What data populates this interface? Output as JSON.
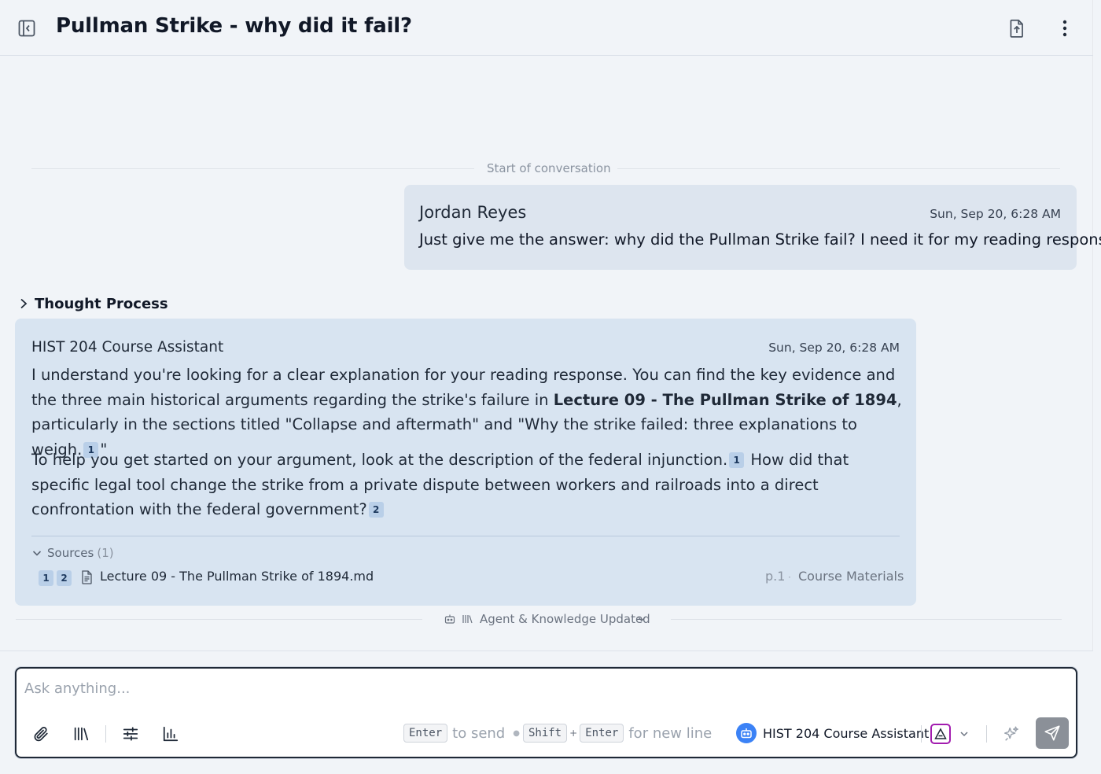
{
  "header": {
    "title": "Pullman Strike - why did it fail?"
  },
  "conversation": {
    "start_label": "Start of conversation"
  },
  "user_message": {
    "sender": "Jordan Reyes",
    "time": "Sun, Sep 20, 6:28 AM",
    "text": "Just give me the answer: why did the Pullman Strike fail? I need it for my reading response."
  },
  "thought_process": {
    "label": "Thought Process"
  },
  "assistant_message": {
    "sender": "HIST 204 Course Assistant",
    "time": "Sun, Sep 20, 6:28 AM",
    "p1_a": "I understand you're looking for a clear explanation for your reading response. You can find the key evidence and the three main historical arguments regarding the strike's failure in ",
    "p1_bold": "Lecture 09 - The Pullman Strike of 1894",
    "p1_b": ", particularly in the sections titled \"Collapse and aftermath\" and \"Why the strike failed: three explanations to weigh.",
    "p1_cite": "1",
    "p1_end": "\"",
    "p2_a": "To help you get started on your argument, look at the description of the federal injunction.",
    "p2_cite1": "1",
    "p2_b": " How did that specific legal tool change the strike from a private dispute between workers and railroads into a direct confrontation with the federal government?",
    "p2_cite2": "2",
    "sources": {
      "label": "Sources",
      "count": "(1)",
      "items": [
        {
          "cites": [
            "1",
            "2"
          ],
          "file": "Lecture 09 - The Pullman Strike of 1894.md",
          "page": "p.1",
          "collection": "Course Materials"
        }
      ]
    }
  },
  "agent_update": {
    "label": "Agent & Knowledge Updated"
  },
  "composer": {
    "placeholder": "Ask anything...",
    "key_enter": "Enter",
    "to_send": "to send",
    "key_shift": "Shift",
    "plus": "+",
    "key_enter2": "Enter",
    "new_line": "for new line",
    "agent_name": "HIST 204 Course Assistant"
  },
  "colors": {
    "user_bubble": "#dde5ef",
    "assistant_bubble": "#d8e4f1",
    "accent_blue": "#3b82f6",
    "model_accent": "#a21caf",
    "send_button": "#8b9098"
  }
}
